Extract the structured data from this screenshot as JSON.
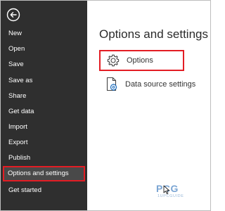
{
  "sidebar": {
    "back_icon": "back-arrow-icon",
    "items": [
      {
        "label": "New"
      },
      {
        "label": "Open"
      },
      {
        "label": "Save"
      },
      {
        "label": "Save as"
      },
      {
        "label": "Share"
      },
      {
        "label": "Get data"
      },
      {
        "label": "Import"
      },
      {
        "label": "Export"
      },
      {
        "label": "Publish"
      },
      {
        "label": "Options and settings",
        "selected": true
      },
      {
        "label": "Get started"
      }
    ]
  },
  "main": {
    "title": "Options and settings",
    "options": [
      {
        "label": "Options",
        "icon": "gear-icon",
        "highlighted": true
      },
      {
        "label": "Data source settings",
        "icon": "data-source-settings-icon"
      }
    ]
  },
  "watermark": {
    "logo": "PCG",
    "subtitle": "1UPCGUIDE"
  },
  "colors": {
    "sidebar_bg": "#2f2f2f",
    "highlight_border": "#e31d24",
    "selected_bg": "#494949"
  }
}
